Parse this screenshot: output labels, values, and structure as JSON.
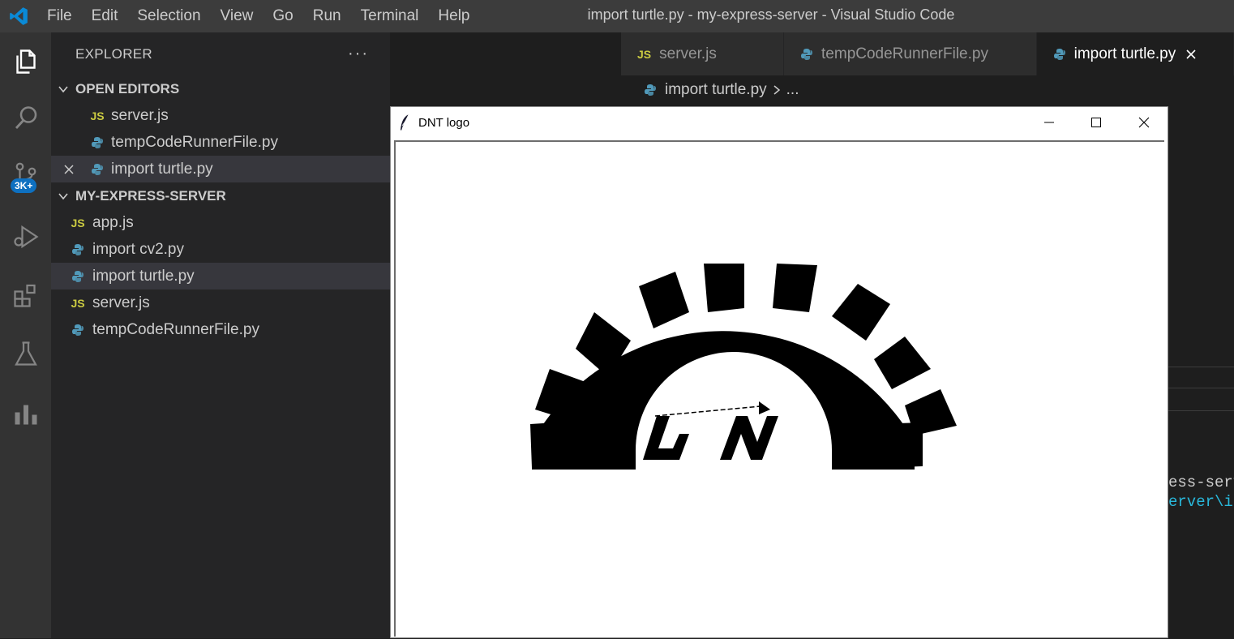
{
  "menu": [
    "File",
    "Edit",
    "Selection",
    "View",
    "Go",
    "Run",
    "Terminal",
    "Help"
  ],
  "window_title": "import turtle.py - my-express-server - Visual Studio Code",
  "activity": {
    "source_control_badge": "3K+"
  },
  "explorer": {
    "title": "EXPLORER",
    "more": "···",
    "open_editors": {
      "label": "OPEN EDITORS",
      "items": [
        {
          "name": "server.js",
          "type": "js"
        },
        {
          "name": "tempCodeRunnerFile.py",
          "type": "py"
        },
        {
          "name": "import turtle.py",
          "type": "py"
        }
      ]
    },
    "project": {
      "label": "MY-EXPRESS-SERVER",
      "items": [
        {
          "name": "app.js",
          "type": "js"
        },
        {
          "name": "import cv2.py",
          "type": "py"
        },
        {
          "name": "import turtle.py",
          "type": "py"
        },
        {
          "name": "server.js",
          "type": "js"
        },
        {
          "name": "tempCodeRunnerFile.py",
          "type": "py"
        }
      ]
    }
  },
  "tabs": [
    {
      "label": "server.js",
      "type": "js"
    },
    {
      "label": "tempCodeRunnerFile.py",
      "type": "py"
    },
    {
      "label": "import turtle.py",
      "type": "py"
    }
  ],
  "breadcrumb": {
    "file": "import turtle.py",
    "rest": "..."
  },
  "terminal_lines": [
    "ess-serv",
    "erver\\i"
  ],
  "turtle_window": {
    "title": "DNT logo"
  },
  "colors": {
    "accent": "#0e70c0",
    "js_icon": "#cbcb41",
    "py_icon": "#519aba"
  }
}
